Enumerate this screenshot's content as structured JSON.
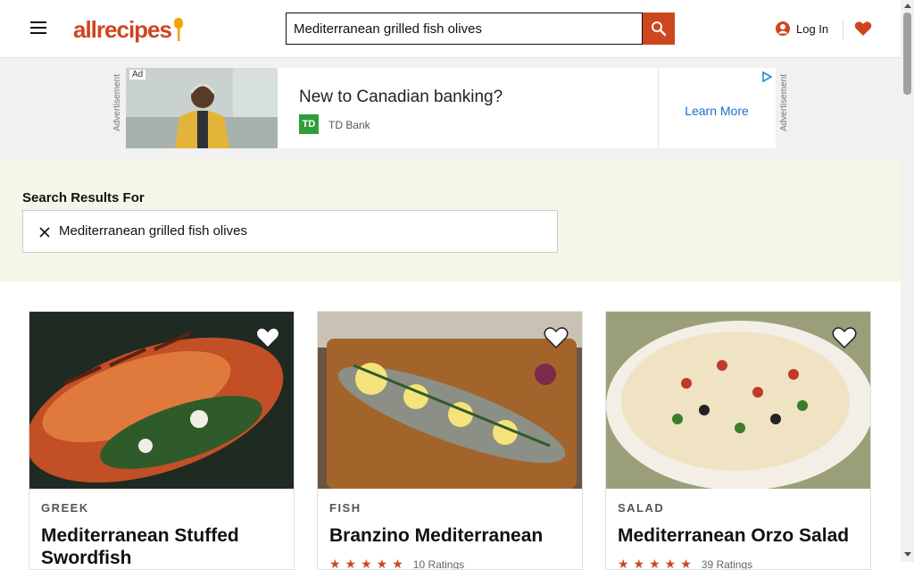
{
  "header": {
    "logo_text": "allrecipes",
    "search_value": "Mediterranean grilled fish olives",
    "login_label": "Log In"
  },
  "ad": {
    "side_label": "Advertisement",
    "tag": "Ad",
    "headline": "New to Canadian banking?",
    "brand_logo": "TD",
    "brand": "TD Bank",
    "cta": "Learn More"
  },
  "results": {
    "label": "Search Results For",
    "query": "Mediterranean grilled fish olives"
  },
  "cards": [
    {
      "tag": "GREEK",
      "title": "Mediterranean Stuffed Swordfish",
      "rating_text": ""
    },
    {
      "tag": "FISH",
      "title": "Branzino Mediterranean",
      "rating_text": "10 Ratings"
    },
    {
      "tag": "SALAD",
      "title": "Mediterranean Orzo Salad",
      "rating_text": "39 Ratings"
    }
  ],
  "colors": {
    "brand": "#ce4620",
    "results_bg": "#f5f5e8",
    "ad_band": "#f1f1f1"
  }
}
